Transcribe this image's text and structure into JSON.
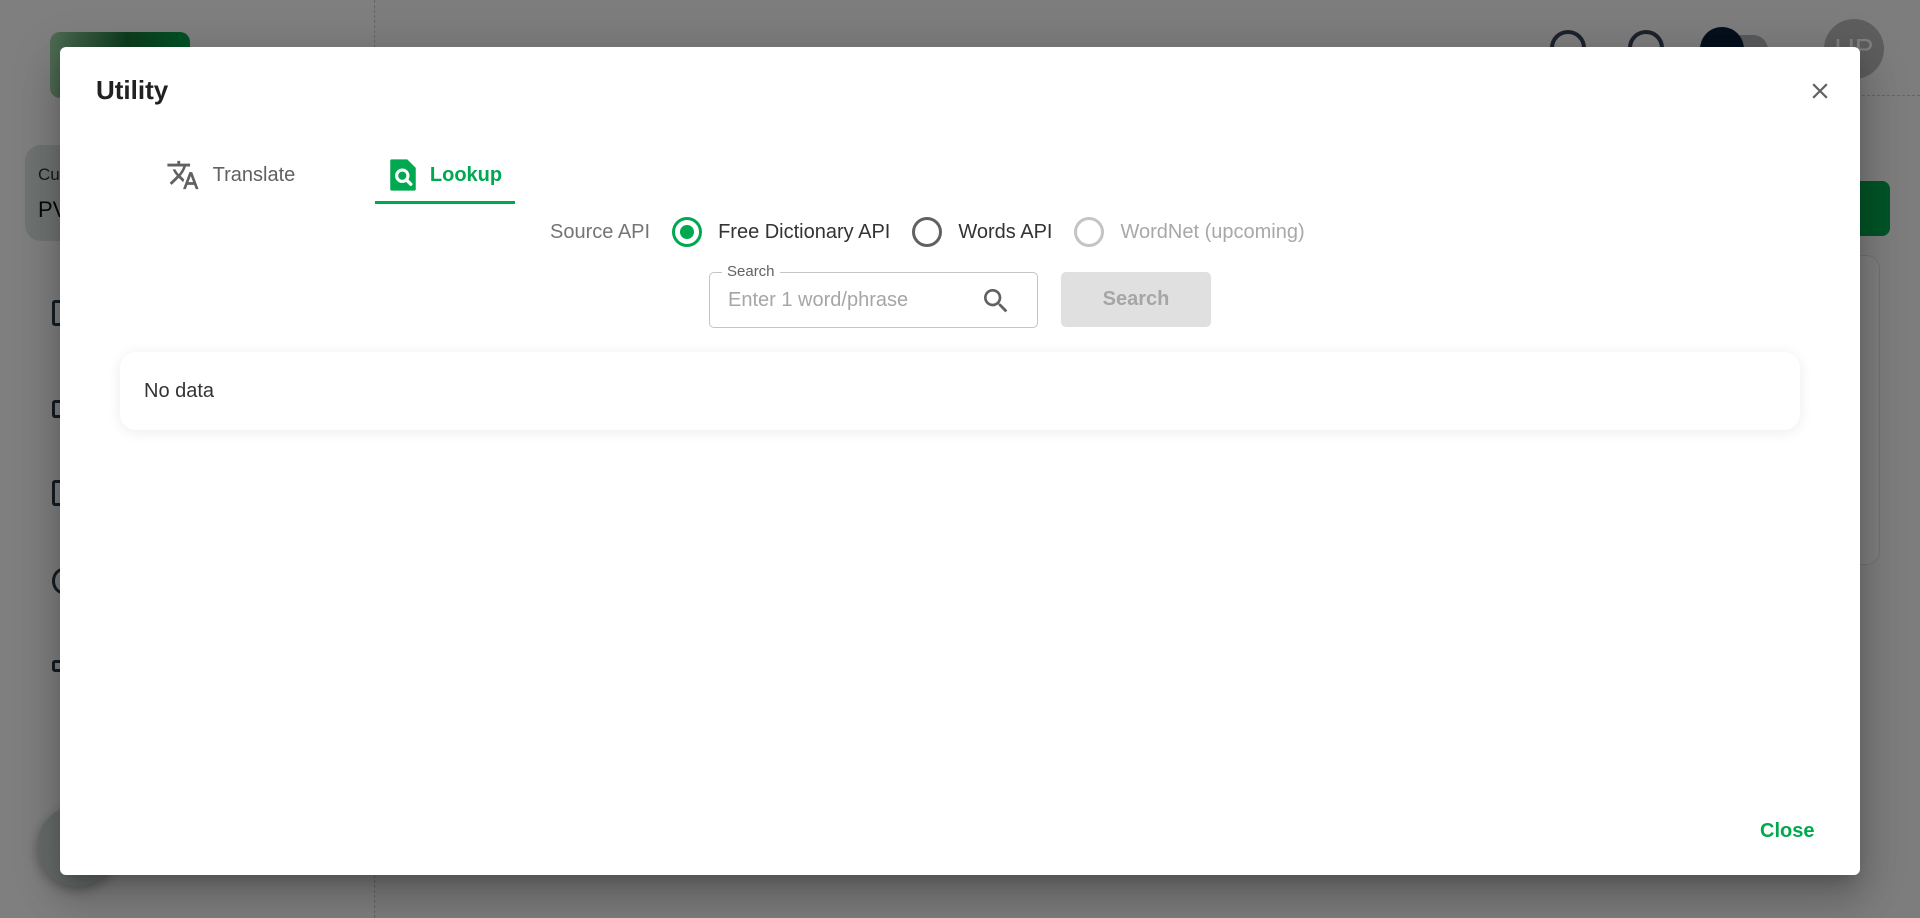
{
  "background": {
    "current_card": {
      "label": "Cu",
      "value": "PV"
    },
    "avatar_initials": "UP"
  },
  "dialog": {
    "title": "Utility",
    "tabs": [
      {
        "label": "Translate",
        "icon": "translate-icon",
        "active": false
      },
      {
        "label": "Lookup",
        "icon": "document-search-icon",
        "active": true
      }
    ],
    "source_api": {
      "label": "Source API",
      "options": [
        {
          "label": "Free Dictionary API",
          "checked": true,
          "disabled": false
        },
        {
          "label": "Words API",
          "checked": false,
          "disabled": false
        },
        {
          "label": "WordNet (upcoming)",
          "checked": false,
          "disabled": true
        }
      ]
    },
    "search": {
      "legend": "Search",
      "placeholder": "Enter 1 word/phrase",
      "value": "",
      "button_label": "Search"
    },
    "result": {
      "empty_text": "No data"
    },
    "footer": {
      "close_label": "Close"
    }
  },
  "colors": {
    "accent": "#00a94f",
    "text_primary": "#212121",
    "text_secondary": "#616161",
    "disabled": "#a8a8a8"
  }
}
